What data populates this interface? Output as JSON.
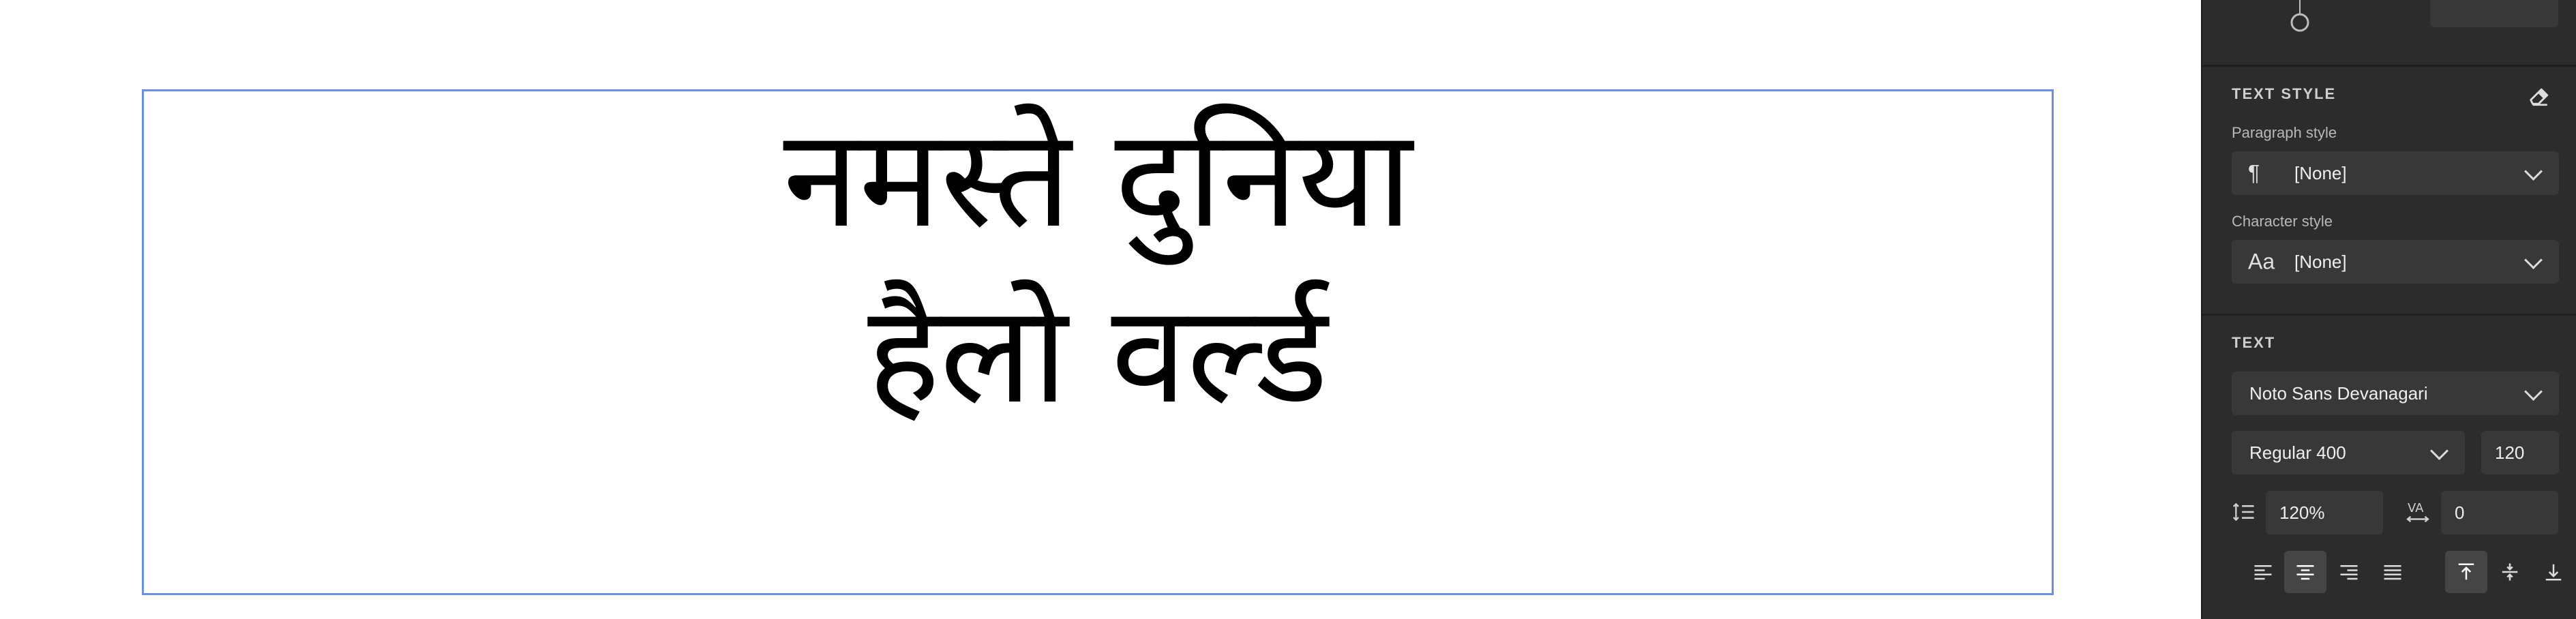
{
  "canvas": {
    "text_lines": [
      "नमस्ते दुनिया",
      "हैलो वर्ल्ड"
    ]
  },
  "panel": {
    "text_style": {
      "title": "TEXT STYLE",
      "paragraph_label": "Paragraph style",
      "paragraph_value": "[None]",
      "character_label": "Character style",
      "character_value": "[None]",
      "character_glyph": "Aa",
      "paragraph_glyph": "¶"
    },
    "text": {
      "title": "TEXT",
      "font_family": "Noto Sans Devanagari",
      "font_weight": "Regular 400",
      "font_size": "120",
      "line_height": "120%",
      "letter_spacing": "0"
    },
    "alignment": {
      "horizontal_options": [
        "left",
        "center",
        "right",
        "justify"
      ],
      "horizontal_selected": "center",
      "vertical_options": [
        "top",
        "middle",
        "bottom"
      ],
      "vertical_selected": "top"
    },
    "colors": {
      "panel_bg": "#2c2c2c",
      "field_bg": "#383838",
      "selection": "#6b8fe6"
    }
  }
}
